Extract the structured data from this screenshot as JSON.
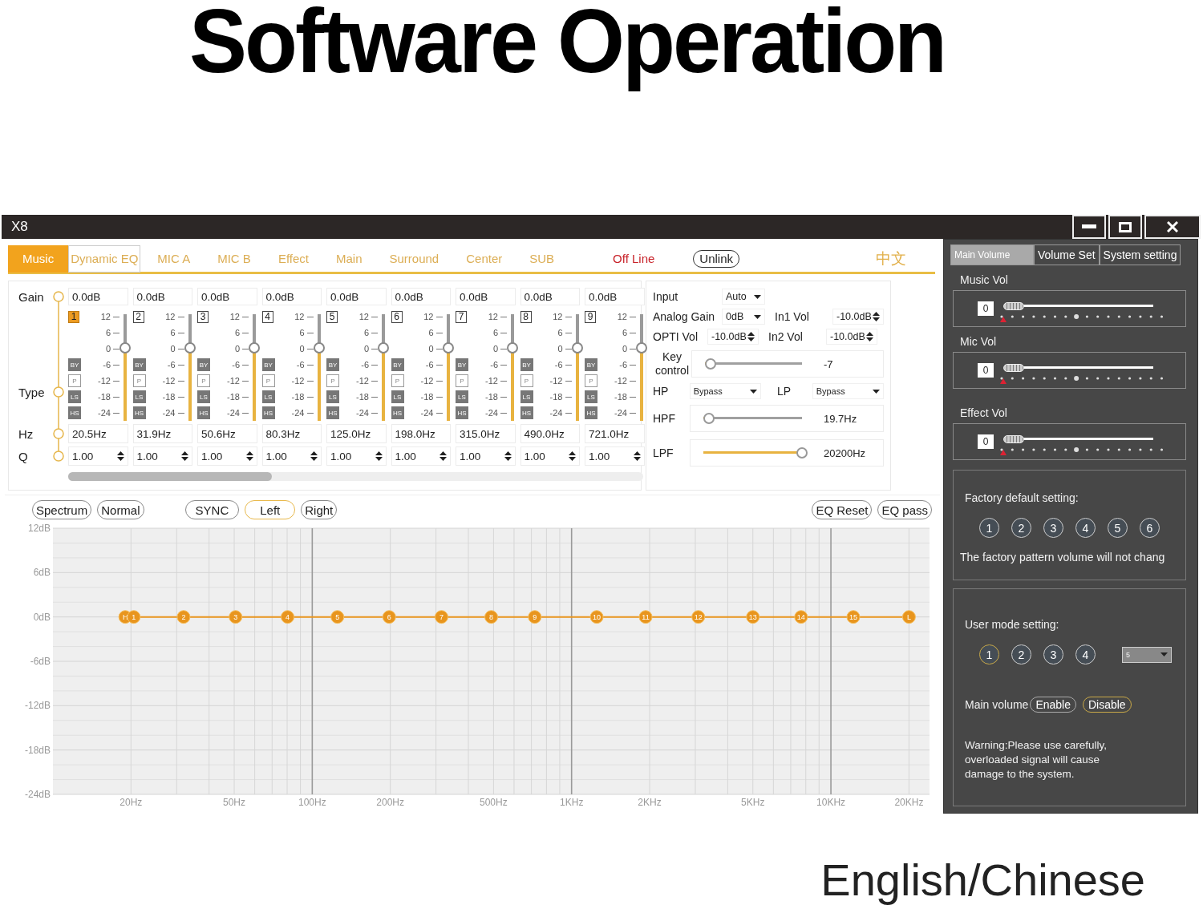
{
  "header": {
    "title": "Software Operation",
    "caption": "English/Chinese"
  },
  "window": {
    "title": "X8"
  },
  "tabs": [
    {
      "label": "Music",
      "selected": true
    },
    {
      "label": "Dynamic EQ",
      "selected": false
    },
    {
      "label": "MIC A",
      "selected": false
    },
    {
      "label": "MIC B",
      "selected": false
    },
    {
      "label": "Effect",
      "selected": false
    },
    {
      "label": "Main",
      "selected": false
    },
    {
      "label": "Surround",
      "selected": false
    },
    {
      "label": "Center",
      "selected": false
    },
    {
      "label": "SUB",
      "selected": false
    }
  ],
  "status": "Off Line",
  "unlink_button": "Unlink",
  "language_button": "中文",
  "eq_row_labels": {
    "gain": "Gain",
    "type": "Type",
    "hz": "Hz",
    "q": "Q"
  },
  "bands": [
    {
      "number": "1",
      "selected": true,
      "gain": "0.0dB",
      "level": 0.667,
      "scale": [
        "12",
        "6",
        "0",
        "-6",
        "-12",
        "-18",
        "-24"
      ],
      "types": [
        {
          "label": "BY",
          "selected": false
        },
        {
          "label": "P",
          "selected": true
        },
        {
          "label": "LS",
          "selected": false
        },
        {
          "label": "HS",
          "selected": false
        }
      ],
      "freq": "20.5Hz",
      "q": "1.00"
    },
    {
      "number": "2",
      "selected": false,
      "gain": "0.0dB",
      "level": 0.667,
      "scale": [
        "12",
        "6",
        "0",
        "-6",
        "-12",
        "-18",
        "-24"
      ],
      "types": [
        {
          "label": "BY",
          "selected": false
        },
        {
          "label": "P",
          "selected": true
        },
        {
          "label": "LS",
          "selected": false
        },
        {
          "label": "HS",
          "selected": false
        }
      ],
      "freq": "31.9Hz",
      "q": "1.00"
    },
    {
      "number": "3",
      "selected": false,
      "gain": "0.0dB",
      "level": 0.667,
      "scale": [
        "12",
        "6",
        "0",
        "-6",
        "-12",
        "-18",
        "-24"
      ],
      "types": [
        {
          "label": "BY",
          "selected": false
        },
        {
          "label": "P",
          "selected": true
        },
        {
          "label": "LS",
          "selected": false
        },
        {
          "label": "HS",
          "selected": false
        }
      ],
      "freq": "50.6Hz",
      "q": "1.00"
    },
    {
      "number": "4",
      "selected": false,
      "gain": "0.0dB",
      "level": 0.667,
      "scale": [
        "12",
        "6",
        "0",
        "-6",
        "-12",
        "-18",
        "-24"
      ],
      "types": [
        {
          "label": "BY",
          "selected": false
        },
        {
          "label": "P",
          "selected": true
        },
        {
          "label": "LS",
          "selected": false
        },
        {
          "label": "HS",
          "selected": false
        }
      ],
      "freq": "80.3Hz",
      "q": "1.00"
    },
    {
      "number": "5",
      "selected": false,
      "gain": "0.0dB",
      "level": 0.667,
      "scale": [
        "12",
        "6",
        "0",
        "-6",
        "-12",
        "-18",
        "-24"
      ],
      "types": [
        {
          "label": "BY",
          "selected": false
        },
        {
          "label": "P",
          "selected": true
        },
        {
          "label": "LS",
          "selected": false
        },
        {
          "label": "HS",
          "selected": false
        }
      ],
      "freq": "125.0Hz",
      "q": "1.00"
    },
    {
      "number": "6",
      "selected": false,
      "gain": "0.0dB",
      "level": 0.667,
      "scale": [
        "12",
        "6",
        "0",
        "-6",
        "-12",
        "-18",
        "-24"
      ],
      "types": [
        {
          "label": "BY",
          "selected": false
        },
        {
          "label": "P",
          "selected": true
        },
        {
          "label": "LS",
          "selected": false
        },
        {
          "label": "HS",
          "selected": false
        }
      ],
      "freq": "198.0Hz",
      "q": "1.00"
    },
    {
      "number": "7",
      "selected": false,
      "gain": "0.0dB",
      "level": 0.667,
      "scale": [
        "12",
        "6",
        "0",
        "-6",
        "-12",
        "-18",
        "-24"
      ],
      "types": [
        {
          "label": "BY",
          "selected": false
        },
        {
          "label": "P",
          "selected": true
        },
        {
          "label": "LS",
          "selected": false
        },
        {
          "label": "HS",
          "selected": false
        }
      ],
      "freq": "315.0Hz",
      "q": "1.00"
    },
    {
      "number": "8",
      "selected": false,
      "gain": "0.0dB",
      "level": 0.667,
      "scale": [
        "12",
        "6",
        "0",
        "-6",
        "-12",
        "-18",
        "-24"
      ],
      "types": [
        {
          "label": "BY",
          "selected": false
        },
        {
          "label": "P",
          "selected": true
        },
        {
          "label": "LS",
          "selected": false
        },
        {
          "label": "HS",
          "selected": false
        }
      ],
      "freq": "490.0Hz",
      "q": "1.00"
    },
    {
      "number": "9",
      "selected": false,
      "gain": "0.0dB",
      "level": 0.667,
      "scale": [
        "12",
        "6",
        "0",
        "-6",
        "-12",
        "-18",
        "-24"
      ],
      "types": [
        {
          "label": "BY",
          "selected": false
        },
        {
          "label": "P",
          "selected": true
        },
        {
          "label": "LS",
          "selected": false
        },
        {
          "label": "HS",
          "selected": false
        }
      ],
      "freq": "721.0Hz",
      "q": "1.00"
    }
  ],
  "settings": {
    "input": {
      "label": "Input",
      "value": "Auto"
    },
    "analog_gain": {
      "label": "Analog Gain",
      "value": "0dB"
    },
    "in1_vol": {
      "label": "In1 Vol",
      "value": "-10.0dB"
    },
    "opti_vol": {
      "label": "OPTI Vol",
      "value": "-10.0dB"
    },
    "in2_vol": {
      "label": "In2 Vol",
      "value": "-10.0dB"
    },
    "key_control": {
      "label": "Key control",
      "level": 0,
      "reading": "-7"
    },
    "hp": {
      "label": "HP",
      "value": "Bypass"
    },
    "lp": {
      "label": "LP",
      "value": "Bypass"
    },
    "hpf": {
      "label": "HPF",
      "level": 0,
      "reading": "19.7Hz"
    },
    "lpf": {
      "label": "LPF",
      "level": 1,
      "reading": "20200Hz"
    }
  },
  "graph_buttons": [
    {
      "label": "Spectrum",
      "selected": false
    },
    {
      "label": "Normal",
      "selected": false
    },
    {
      "label": "SYNC",
      "selected": false
    },
    {
      "label": "Left",
      "selected": true
    },
    {
      "label": "Right",
      "selected": false
    }
  ],
  "graph_actions": [
    "EQ Reset",
    "EQ pass"
  ],
  "eq_graph": {
    "frequency_labels": [
      "20Hz",
      "50Hz",
      "100Hz",
      "200Hz",
      "500Hz",
      "1KHz",
      "2KHz",
      "5KHz",
      "10KHz",
      "20KHz"
    ],
    "chart_data": {
      "type": "line",
      "categories": [
        "H",
        "1",
        "2",
        "3",
        "4",
        "5",
        "6",
        "7",
        "8",
        "9",
        "10",
        "11",
        "12",
        "13",
        "14",
        "15",
        "L"
      ],
      "grid": true,
      "series": [
        {
          "marker": true,
          "color": "#e8951e",
          "values": [
            0,
            0,
            0,
            0,
            0,
            0,
            0,
            0,
            0,
            0,
            0,
            0,
            0,
            0,
            0,
            0,
            0
          ]
        }
      ],
      "ylim": [
        -24,
        12
      ],
      "yticks": [
        {
          "value": 12,
          "label": "12dB"
        },
        {
          "value": 6,
          "label": "6dB"
        },
        {
          "value": 0,
          "label": "0dB"
        },
        {
          "value": -6,
          "label": "-6dB"
        },
        {
          "value": -12,
          "label": "-12dB"
        },
        {
          "value": -18,
          "label": "-18dB"
        },
        {
          "value": -24,
          "label": "-24dB"
        }
      ]
    }
  },
  "side_panel": {
    "tabs": [
      {
        "label": "Main Volume",
        "selected": true
      },
      {
        "label": "Volume Set",
        "selected": false
      },
      {
        "label": "System setting",
        "selected": false
      }
    ],
    "volumes": [
      {
        "label": "Music Vol",
        "value": "0",
        "level": 0
      },
      {
        "label": "Mic Vol",
        "value": "0",
        "level": 0
      },
      {
        "label": "Effect Vol",
        "value": "0",
        "level": 0
      }
    ],
    "factory": {
      "title": "Factory default setting:",
      "presets": [
        {
          "label": "1",
          "selected": false
        },
        {
          "label": "2",
          "selected": false
        },
        {
          "label": "3",
          "selected": false
        },
        {
          "label": "4",
          "selected": false
        },
        {
          "label": "5",
          "selected": false
        },
        {
          "label": "6",
          "selected": false
        }
      ],
      "note": "The factory pattern volume will not chang"
    },
    "user_mode": {
      "title": "User mode setting:",
      "presets": [
        {
          "label": "1",
          "selected": true
        },
        {
          "label": "2",
          "selected": false
        },
        {
          "label": "3",
          "selected": false
        },
        {
          "label": "4",
          "selected": false
        }
      ],
      "dropdown": "5",
      "main_volume_label": "Main volume",
      "main_volume_options": [
        {
          "label": "Enable",
          "selected": false
        },
        {
          "label": "Disable",
          "selected": true
        }
      ],
      "warning": "Warning:Please use carefully, overloaded signal will cause damage to the system."
    }
  }
}
